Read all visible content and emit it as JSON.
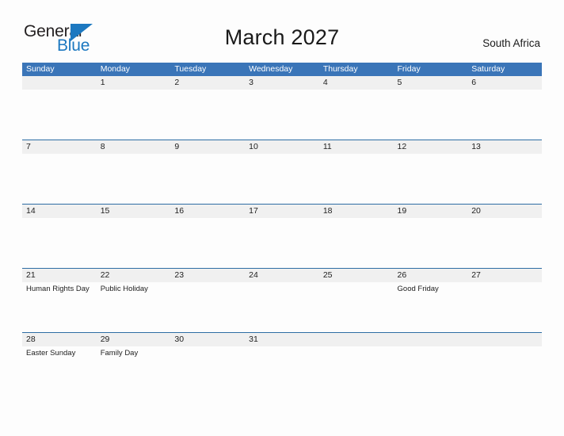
{
  "brand": {
    "name_part1": "General",
    "name_part2": "Blue",
    "flag_color": "#1C78C0",
    "text_color": "#231F20"
  },
  "header": {
    "title": "March 2027",
    "locale": "South Africa"
  },
  "theme": {
    "header_blue": "#3A75B8",
    "row_border_blue": "#2E6DA4",
    "day_band_gray": "#F0F0F0",
    "page_background": "#FDFDFD",
    "text_color": "#212121"
  },
  "calendar": {
    "weekdays": [
      "Sunday",
      "Monday",
      "Tuesday",
      "Wednesday",
      "Thursday",
      "Friday",
      "Saturday"
    ],
    "weeks": [
      [
        {
          "date": "",
          "event": ""
        },
        {
          "date": "1",
          "event": ""
        },
        {
          "date": "2",
          "event": ""
        },
        {
          "date": "3",
          "event": ""
        },
        {
          "date": "4",
          "event": ""
        },
        {
          "date": "5",
          "event": ""
        },
        {
          "date": "6",
          "event": ""
        }
      ],
      [
        {
          "date": "7",
          "event": ""
        },
        {
          "date": "8",
          "event": ""
        },
        {
          "date": "9",
          "event": ""
        },
        {
          "date": "10",
          "event": ""
        },
        {
          "date": "11",
          "event": ""
        },
        {
          "date": "12",
          "event": ""
        },
        {
          "date": "13",
          "event": ""
        }
      ],
      [
        {
          "date": "14",
          "event": ""
        },
        {
          "date": "15",
          "event": ""
        },
        {
          "date": "16",
          "event": ""
        },
        {
          "date": "17",
          "event": ""
        },
        {
          "date": "18",
          "event": ""
        },
        {
          "date": "19",
          "event": ""
        },
        {
          "date": "20",
          "event": ""
        }
      ],
      [
        {
          "date": "21",
          "event": "Human Rights Day"
        },
        {
          "date": "22",
          "event": "Public Holiday"
        },
        {
          "date": "23",
          "event": ""
        },
        {
          "date": "24",
          "event": ""
        },
        {
          "date": "25",
          "event": ""
        },
        {
          "date": "26",
          "event": "Good Friday"
        },
        {
          "date": "27",
          "event": ""
        }
      ],
      [
        {
          "date": "28",
          "event": "Easter Sunday"
        },
        {
          "date": "29",
          "event": "Family Day"
        },
        {
          "date": "30",
          "event": ""
        },
        {
          "date": "31",
          "event": ""
        },
        {
          "date": "",
          "event": ""
        },
        {
          "date": "",
          "event": ""
        },
        {
          "date": "",
          "event": ""
        }
      ]
    ]
  }
}
